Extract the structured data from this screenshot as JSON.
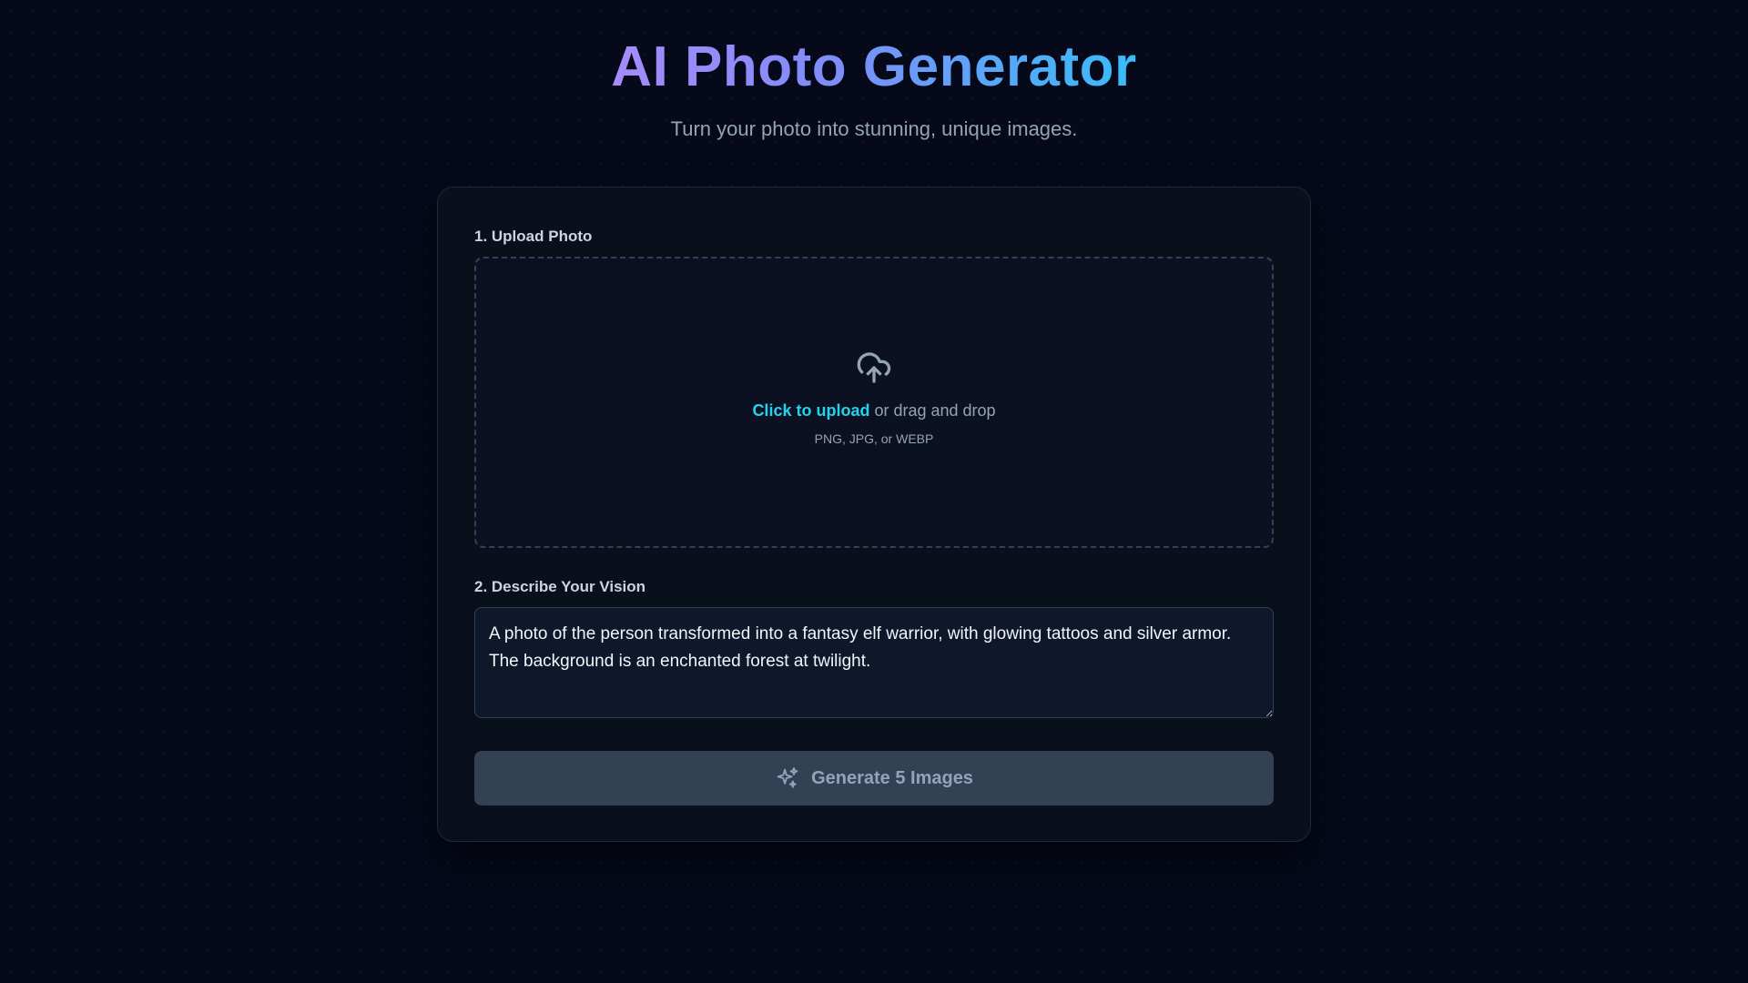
{
  "header": {
    "title": "AI Photo Generator",
    "subtitle": "Turn your photo into stunning, unique images."
  },
  "upload": {
    "label": "1. Upload Photo",
    "icon": "cloud-upload-icon",
    "link_text": "Click to upload",
    "rest_text": " or drag and drop",
    "hint": "PNG, JPG, or WEBP"
  },
  "vision": {
    "label": "2. Describe Your Vision",
    "value": "A photo of the person transformed into a fantasy elf warrior, with glowing tattoos and silver armor. The background is an enchanted forest at twilight."
  },
  "generate": {
    "label": "Generate 5 Images",
    "icon": "sparkles-icon"
  },
  "colors": {
    "background": "#05091a",
    "card": "#0a0f1c",
    "accent": "#22d3ee",
    "title_gradient_start": "#a78bfa",
    "title_gradient_end": "#38bdf8",
    "button": "#334155"
  }
}
